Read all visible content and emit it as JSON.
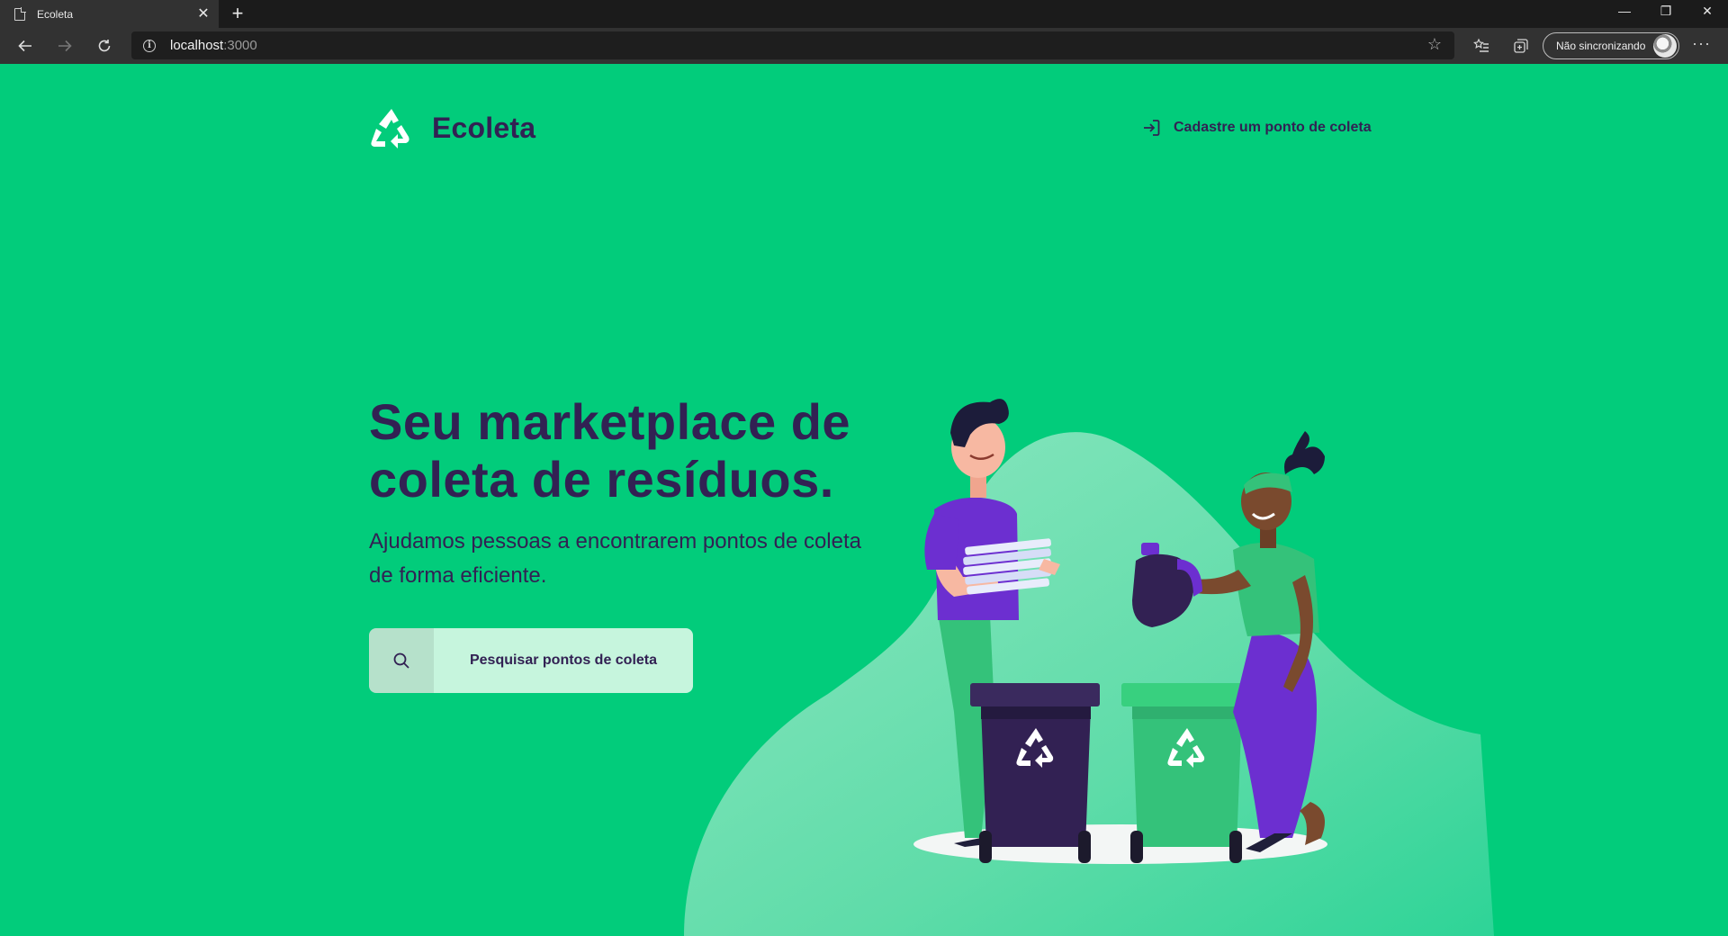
{
  "browser": {
    "tab_title": "Ecoleta",
    "tab_close": "✕",
    "new_tab": "+",
    "url_host": "localhost",
    "url_port": ":3000",
    "sync_label": "Não sincronizando",
    "more": "···"
  },
  "header": {
    "logo_text": "Ecoleta",
    "signup_link": "Cadastre um ponto de coleta"
  },
  "hero": {
    "title": "Seu marketplace de coleta de resíduos.",
    "subtitle": "Ajudamos pessoas a encontrarem pontos de coleta de forma eficiente.",
    "search_button": "Pesquisar pontos de coleta"
  },
  "colors": {
    "background": "#02cc7b",
    "primary_text": "#322153",
    "button_bg": "#c6f5dd"
  },
  "icons": [
    "recycle-logo-icon",
    "sign-in-icon",
    "search-icon",
    "back-icon",
    "forward-icon",
    "refresh-icon",
    "info-icon",
    "star-icon",
    "favorites-icon",
    "collections-icon"
  ]
}
